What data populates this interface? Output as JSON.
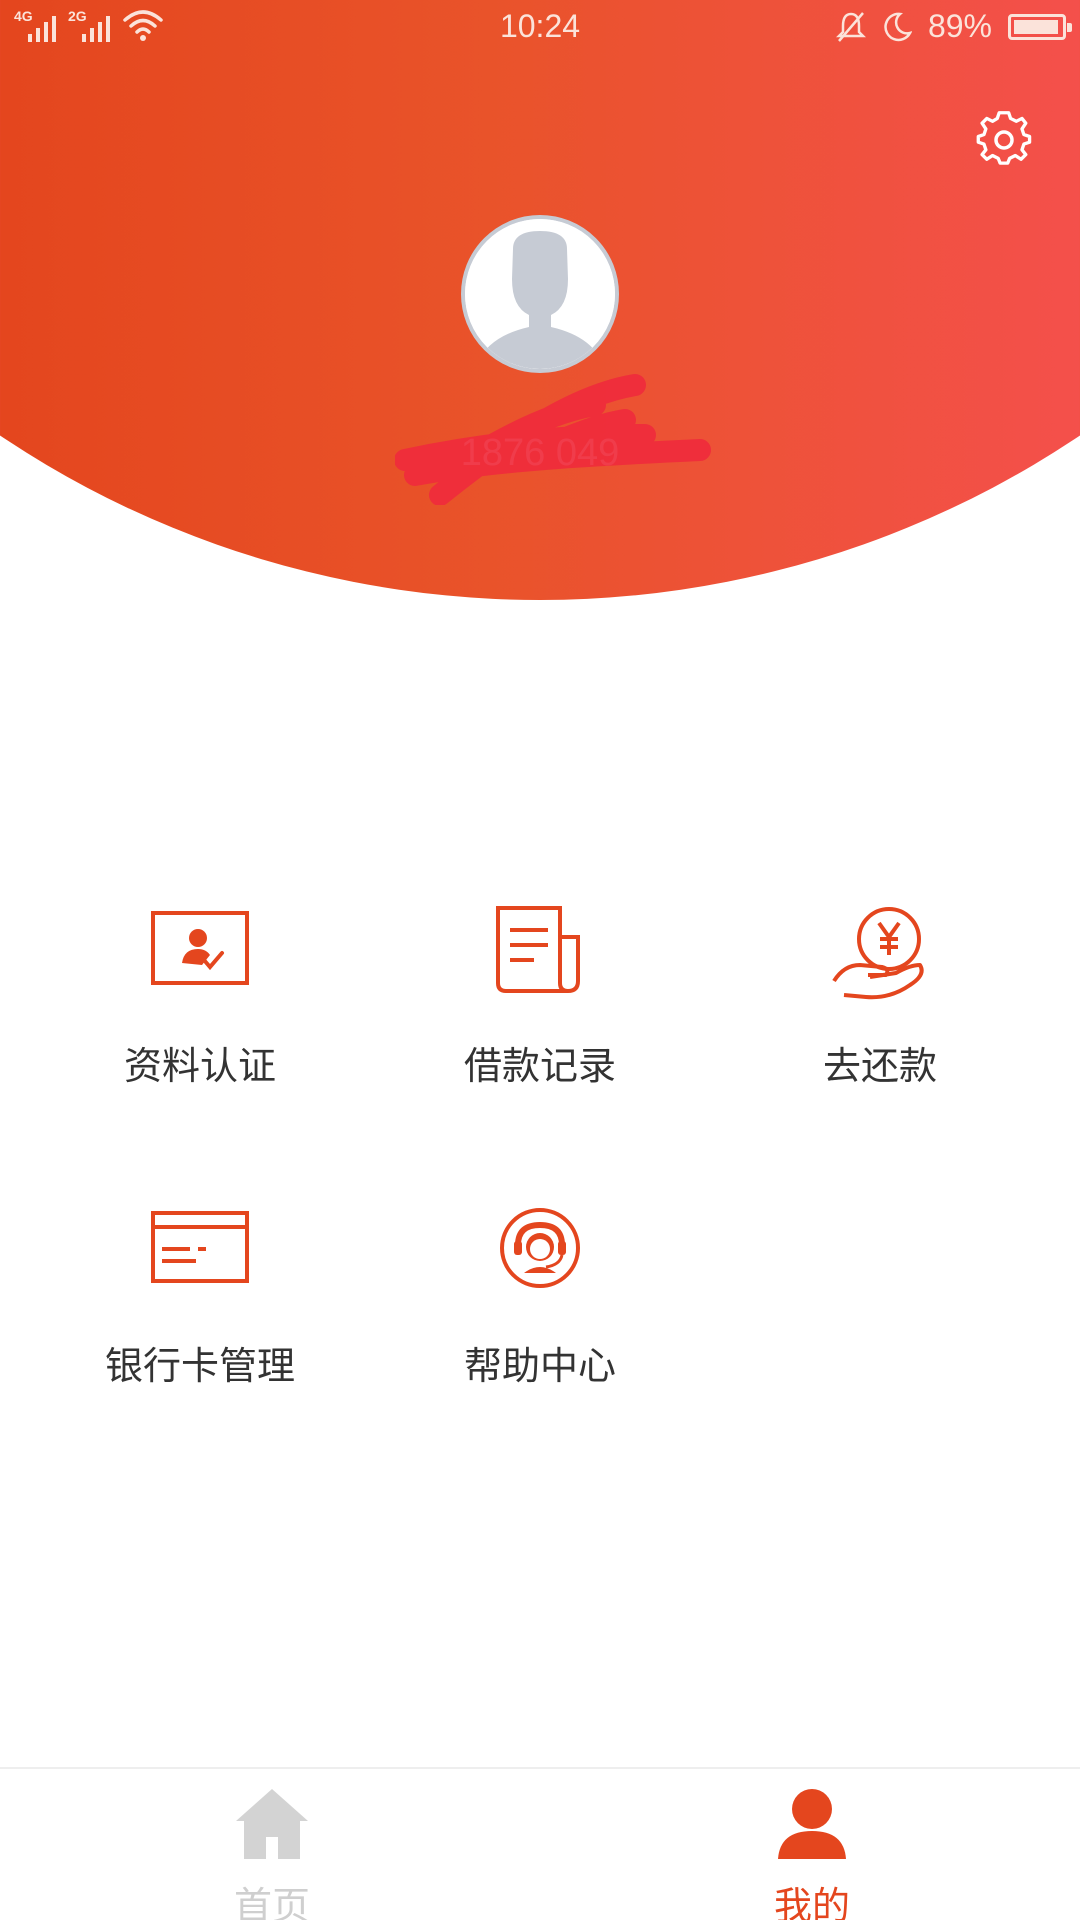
{
  "status_bar": {
    "network_1": "4G",
    "network_2": "2G",
    "time": "10:24",
    "battery": "89%",
    "battery_level": 0.89
  },
  "profile": {
    "phone_masked": "1876    049"
  },
  "menu": [
    {
      "label": "资料认证",
      "icon": "id-card-verify-icon"
    },
    {
      "label": "借款记录",
      "icon": "document-record-icon"
    },
    {
      "label": "去还款",
      "icon": "hand-yen-coin-icon"
    },
    {
      "label": "银行卡管理",
      "icon": "bank-card-icon"
    },
    {
      "label": "帮助中心",
      "icon": "customer-service-headset-icon"
    }
  ],
  "tabbar": {
    "home_label": "首页",
    "mine_label": "我的",
    "active": "mine"
  },
  "colors": {
    "accent": "#e4461e",
    "accent_end": "#f4504b",
    "inactive_tab": "#cfcfcf",
    "text": "#333333"
  }
}
